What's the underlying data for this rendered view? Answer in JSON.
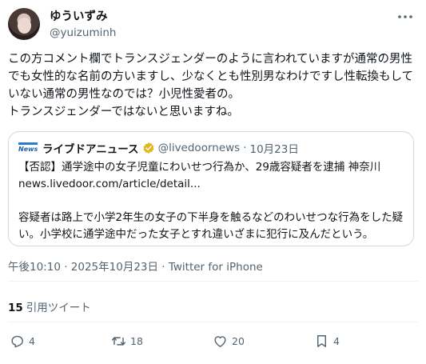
{
  "author": {
    "display_name": "ゆういずみ",
    "handle": "@yuizuminh",
    "avatar_icon": "user-avatar"
  },
  "tweet": {
    "text": "この方コメント欄でトランスジェンダーのように言われていますが通常の男性でも女性的な名前の方いますし、少なくとも性別男なわけですし性転換もしていない通常の男性なのでは？小児性愛者の。\nトランスジェンダーではないと思いますね。"
  },
  "quoted": {
    "logo_text": "News",
    "name": "ライブドアニュース",
    "handle": "@livedoornews",
    "separator": "·",
    "date": "10月23日",
    "body": "【否認】通学途中の女子児童にわいせつ行為か、29歳容疑者を逮捕 神奈川\nnews.livedoor.com/article/detail...\n\n容疑者は路上で小学2年生の女子の下半身を触るなどのわいせつな行為をした疑い。小学校に通学途中だった女子とすれ違いざまに犯行に及んだという。",
    "verified_icon": "verified-badge-gold",
    "verified_color": "#e2b719"
  },
  "timestamp": "午後10:10 · 2025年10月23日 · Twitter for iPhone",
  "stats": {
    "quote_count": "15",
    "quote_label": "引用ツイート"
  },
  "actions": {
    "reply_count": "4",
    "retweet_count": "18",
    "like_count": "20",
    "bookmark_count": "4"
  },
  "colors": {
    "text": "#0f1419",
    "secondary": "#536471",
    "border": "#cfd9de"
  }
}
